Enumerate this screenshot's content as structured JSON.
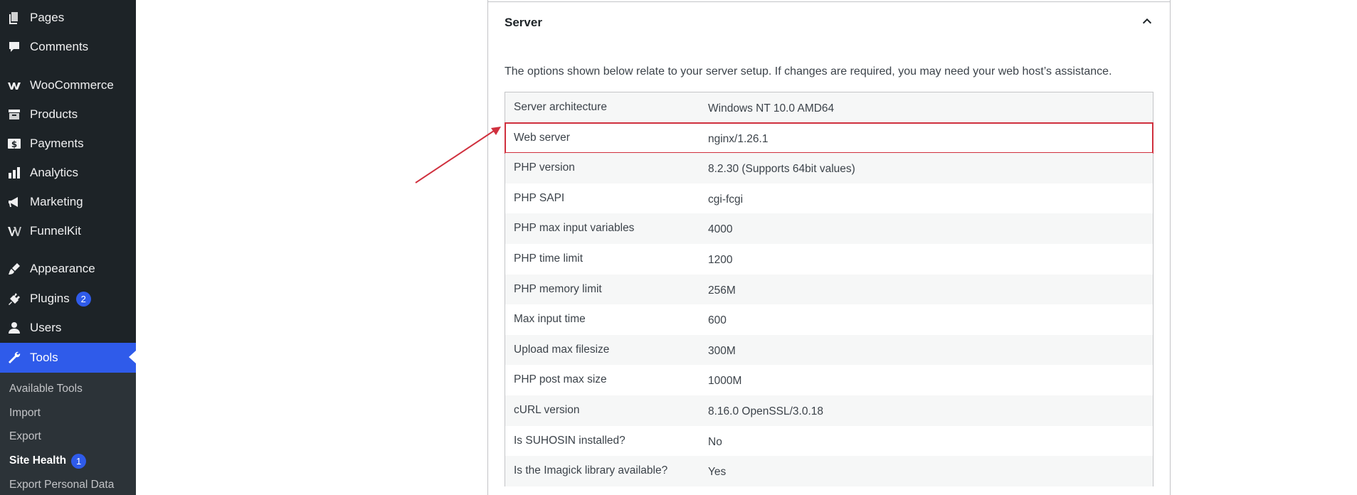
{
  "sidebar": {
    "items": [
      {
        "label": "Pages",
        "icon": "pages-icon"
      },
      {
        "label": "Comments",
        "icon": "comments-icon"
      },
      {
        "label": "WooCommerce",
        "icon": "woocommerce-icon"
      },
      {
        "label": "Products",
        "icon": "products-icon"
      },
      {
        "label": "Payments",
        "icon": "payments-icon"
      },
      {
        "label": "Analytics",
        "icon": "analytics-icon"
      },
      {
        "label": "Marketing",
        "icon": "marketing-icon"
      },
      {
        "label": "FunnelKit",
        "icon": "funnelkit-icon"
      },
      {
        "label": "Appearance",
        "icon": "appearance-icon"
      },
      {
        "label": "Plugins",
        "icon": "plugins-icon",
        "badge": "2"
      },
      {
        "label": "Users",
        "icon": "users-icon"
      },
      {
        "label": "Tools",
        "icon": "tools-icon",
        "active": true
      }
    ],
    "submenu": [
      {
        "label": "Available Tools"
      },
      {
        "label": "Import"
      },
      {
        "label": "Export"
      },
      {
        "label": "Site Health",
        "badge": "1",
        "current": true
      },
      {
        "label": "Export Personal Data"
      }
    ]
  },
  "section": {
    "title": "Server",
    "description": "The options shown below relate to your server setup. If changes are required, you may need your web host’s assistance.",
    "rows": [
      {
        "label": "Server architecture",
        "value": "Windows NT 10.0 AMD64"
      },
      {
        "label": "Web server",
        "value": "nginx/1.26.1",
        "highlighted": true
      },
      {
        "label": "PHP version",
        "value": "8.2.30 (Supports 64bit values)"
      },
      {
        "label": "PHP SAPI",
        "value": "cgi-fcgi"
      },
      {
        "label": "PHP max input variables",
        "value": "4000"
      },
      {
        "label": "PHP time limit",
        "value": "1200"
      },
      {
        "label": "PHP memory limit",
        "value": "256M"
      },
      {
        "label": "Max input time",
        "value": "600"
      },
      {
        "label": "Upload max filesize",
        "value": "300M"
      },
      {
        "label": "PHP post max size",
        "value": "1000M"
      },
      {
        "label": "cURL version",
        "value": "8.16.0 OpenSSL/3.0.18"
      },
      {
        "label": "Is SUHOSIN installed?",
        "value": "No"
      },
      {
        "label": "Is the Imagick library available?",
        "value": "Yes"
      }
    ]
  },
  "colors": {
    "sidebar_bg": "#1d2327",
    "submenu_bg": "#2c3338",
    "accent": "#2f5bea",
    "highlight": "#d0303e"
  }
}
